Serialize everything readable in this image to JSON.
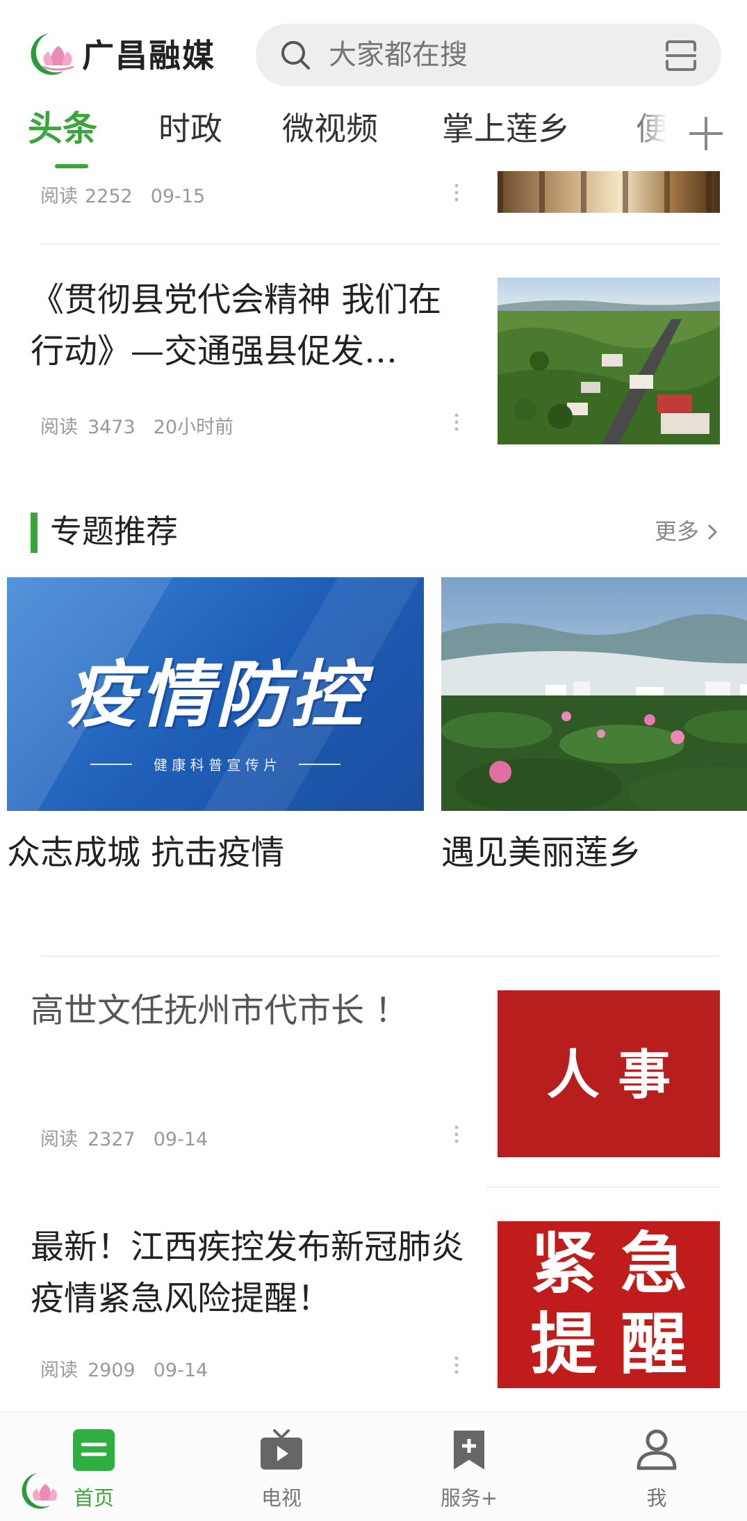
{
  "app": {
    "name": "广昌融媒"
  },
  "search": {
    "placeholder": "大家都在搜"
  },
  "tabs": [
    {
      "label": "头条",
      "active": true
    },
    {
      "label": "时政"
    },
    {
      "label": "微视频"
    },
    {
      "label": "掌上莲乡"
    },
    {
      "label": "便"
    }
  ],
  "feed": {
    "top_partial": {
      "reads_label": "阅读",
      "reads": "2252",
      "date": "09-15"
    },
    "article1": {
      "title": "《贯彻县党代会精神 我们在行动》—交通强县促发…",
      "reads_label": "阅读",
      "reads": "3473",
      "date": "20小时前"
    },
    "topics": {
      "title": "专题推荐",
      "more": "更多",
      "items": [
        {
          "title": "众志成城 抗击疫情",
          "image_text": "疫情防控",
          "image_subtext": "健 康 科 普 宣 传 片"
        },
        {
          "title": "遇见美丽莲乡"
        }
      ]
    },
    "article2": {
      "title": "高世文任抚州市代市长 ！",
      "image_text": "人 事",
      "reads_label": "阅读",
      "reads": "2327",
      "date": "09-14"
    },
    "article3": {
      "title": "最新！江西疾控发布新冠肺炎疫情紧急风险提醒！",
      "image_line1": "紧 急",
      "image_line2": "提 醒",
      "reads_label": "阅读",
      "reads": "2909",
      "date": "09-14"
    }
  },
  "bottom_nav": [
    {
      "label": "首页",
      "icon": "home-list-icon",
      "active": true
    },
    {
      "label": "电视",
      "icon": "tv-icon"
    },
    {
      "label": "服务+",
      "icon": "bookmark-plus-icon"
    },
    {
      "label": "我",
      "icon": "user-icon"
    }
  ],
  "colors": {
    "brand_green": "#3ba53b",
    "text": "#222222",
    "meta": "#999999",
    "red_banner": "#b81e1e"
  }
}
